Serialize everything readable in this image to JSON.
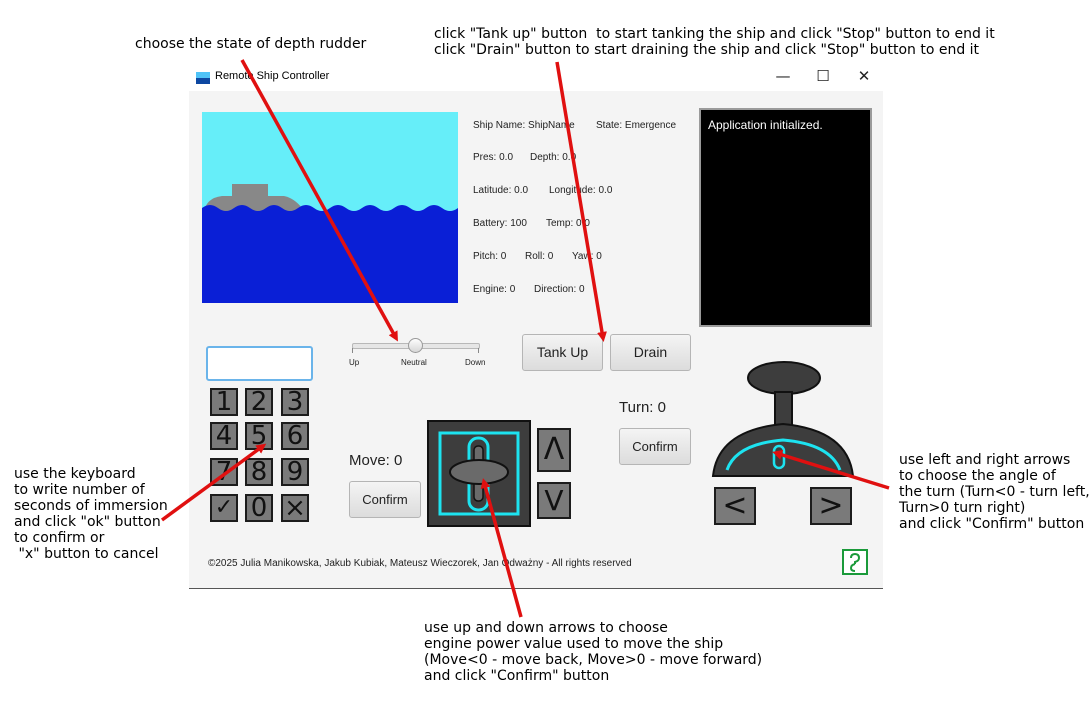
{
  "annotations": {
    "depth_rudder": "choose the state of depth rudder",
    "tank": "click \"Tank up\" button  to start tanking the ship and click \"Stop\" button to end it\nclick \"Drain\" button to start draining the ship and click \"Stop\" button to end it",
    "keyboard": "use the keyboard\nto write number of\nseconds of immersion\nand click \"ok\" button\nto confirm or\n \"x\" button to cancel",
    "move": "use up and down arrows to choose\nengine power value used to move the ship\n(Move<0 - move back, Move>0 - move forward)\nand click \"Confirm\" button",
    "turn": "use left and right arrows\nto choose the angle of\nthe turn (Turn<0 - turn left,\nTurn>0 turn right)\nand click \"Confirm\" button"
  },
  "window": {
    "title": "Remote Ship Controller",
    "minimize": "—",
    "maximize": "☐",
    "close": "✕"
  },
  "info": {
    "ship_name": "Ship Name: ShipName",
    "state": "State: Emergence",
    "pres": "Pres: 0.0",
    "depth": "Depth: 0.0",
    "latitude": "Latitude: 0.0",
    "longitude": "Longitude: 0.0",
    "battery": "Battery: 100",
    "temp": "Temp: 0.0",
    "pitch": "Pitch: 0",
    "roll": "Roll: 0",
    "yaw": "Yaw: 0",
    "engine": "Engine: 0",
    "direction": "Direction: 0"
  },
  "log": {
    "text": "Application initialized."
  },
  "rudder": {
    "up": "Up",
    "neutral": "Neutral",
    "down": "Down",
    "selected": "Neutral"
  },
  "tank": {
    "tank_up": "Tank Up",
    "drain": "Drain"
  },
  "keypad": {
    "input_value": "",
    "keys": [
      "1",
      "2",
      "3",
      "4",
      "5",
      "6",
      "7",
      "8",
      "9",
      "✓",
      "0",
      "×"
    ]
  },
  "move": {
    "label": "Move: 0",
    "confirm": "Confirm",
    "up": "Λ",
    "down": "V"
  },
  "turn": {
    "label": "Turn: 0",
    "confirm": "Confirm",
    "left": "<",
    "right": ">"
  },
  "footer": {
    "copyright": "©2025 Julia Manikowska, Jakub Kubiak, Mateusz Wieczorek, Jan Odważny - All rights reserved",
    "help_icon": "help-icon"
  },
  "colors": {
    "sky": "#66eef9",
    "sea": "#0a1fd6",
    "accent": "#1de3f0",
    "arrow": "#e01010"
  }
}
